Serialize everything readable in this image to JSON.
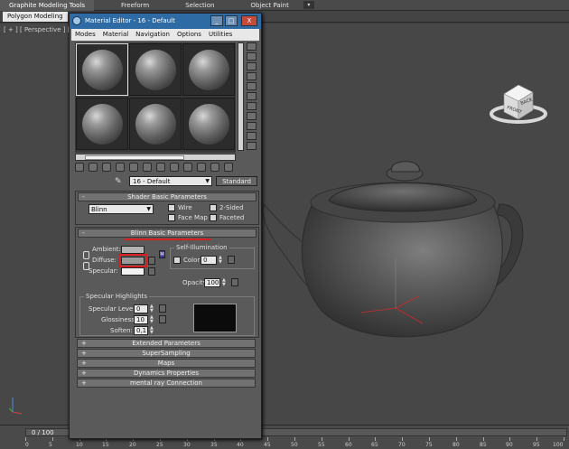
{
  "ribbon": {
    "tabs": [
      "Graphite Modeling Tools",
      "Freeform",
      "Selection",
      "Object Paint"
    ],
    "subtab": "Polygon Modeling"
  },
  "viewport": {
    "label": "[ + ] [ Perspective ] [ Smo",
    "viewcube_front": "FRONT",
    "viewcube_back": "BACK"
  },
  "timeline": {
    "range": "0 / 100",
    "ticks": [
      "0",
      "5",
      "10",
      "15",
      "20",
      "25",
      "30",
      "35",
      "40",
      "45",
      "50",
      "55",
      "60",
      "65",
      "70",
      "75",
      "80",
      "85",
      "90",
      "95",
      "100"
    ]
  },
  "editor": {
    "title": "Material Editor - 16 - Default",
    "window_buttons": {
      "minimize": "_",
      "maximize": "□",
      "close": "X"
    },
    "menu": [
      "Modes",
      "Material",
      "Navigation",
      "Options",
      "Utilities"
    ],
    "material_name": "16 - Default",
    "material_type": "Standard",
    "shader_panel": {
      "title": "Shader Basic Parameters",
      "shader": "Blinn",
      "wire": "Wire",
      "two_sided": "2-Sided",
      "face_map": "Face Map",
      "faceted": "Faceted"
    },
    "blinn_panel": {
      "title": "Blinn Basic Parameters",
      "self_illum_title": "Self-Illumination",
      "color_label": "Color",
      "color_value": "0",
      "ambient": "Ambient:",
      "diffuse": "Diffuse:",
      "specular": "Specular:",
      "opacity_label": "Opacity:",
      "opacity_value": "100",
      "highlights_title": "Specular Highlights",
      "spec_level_label": "Specular Level:",
      "spec_level_value": "0",
      "glossiness_label": "Glossiness:",
      "glossiness_value": "10",
      "soften_label": "Soften:",
      "soften_value": "0,1"
    },
    "rollouts": [
      "Extended Parameters",
      "SuperSampling",
      "Maps",
      "Dynamics Properties",
      "mental ray Connection"
    ],
    "colors": {
      "ambient": "#b4b4b4",
      "diffuse": "#9a9a9a",
      "specular": "#f2f2f2"
    }
  }
}
